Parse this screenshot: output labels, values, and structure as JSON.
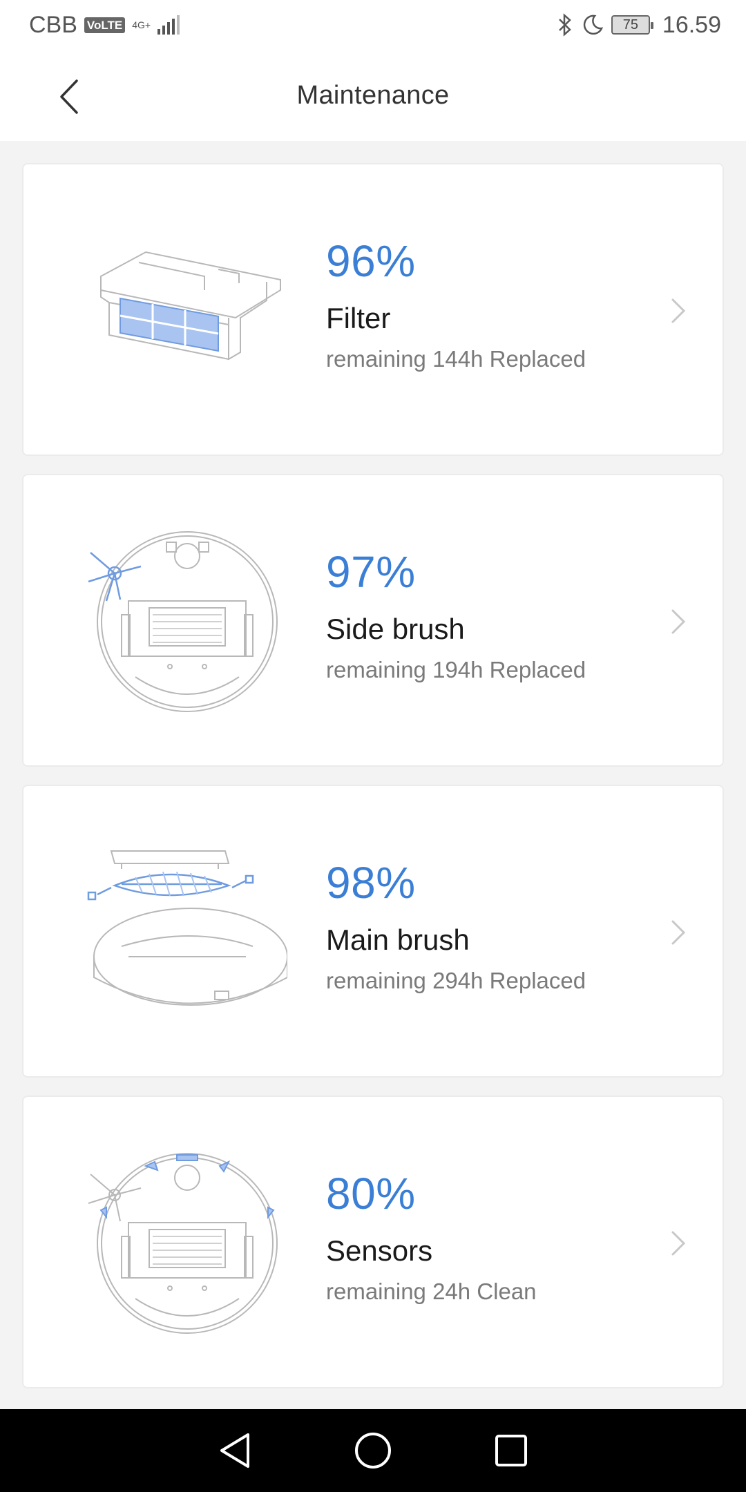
{
  "status_bar": {
    "carrier": "CBB",
    "volte": "VoLTE",
    "network": "4G+",
    "battery": "75",
    "time": "16.59"
  },
  "header": {
    "title": "Maintenance"
  },
  "items": [
    {
      "percent": "96%",
      "name": "Filter",
      "status": "remaining 144h Replaced",
      "icon": "filter-illustration"
    },
    {
      "percent": "97%",
      "name": "Side brush",
      "status": "remaining 194h Replaced",
      "icon": "side-brush-illustration"
    },
    {
      "percent": "98%",
      "name": "Main brush",
      "status": "remaining 294h Replaced",
      "icon": "main-brush-illustration"
    },
    {
      "percent": "80%",
      "name": "Sensors",
      "status": "remaining 24h Clean",
      "icon": "sensors-illustration"
    }
  ],
  "colors": {
    "accent": "#3a7fd5",
    "background": "#f3f3f3",
    "card": "#ffffff"
  }
}
